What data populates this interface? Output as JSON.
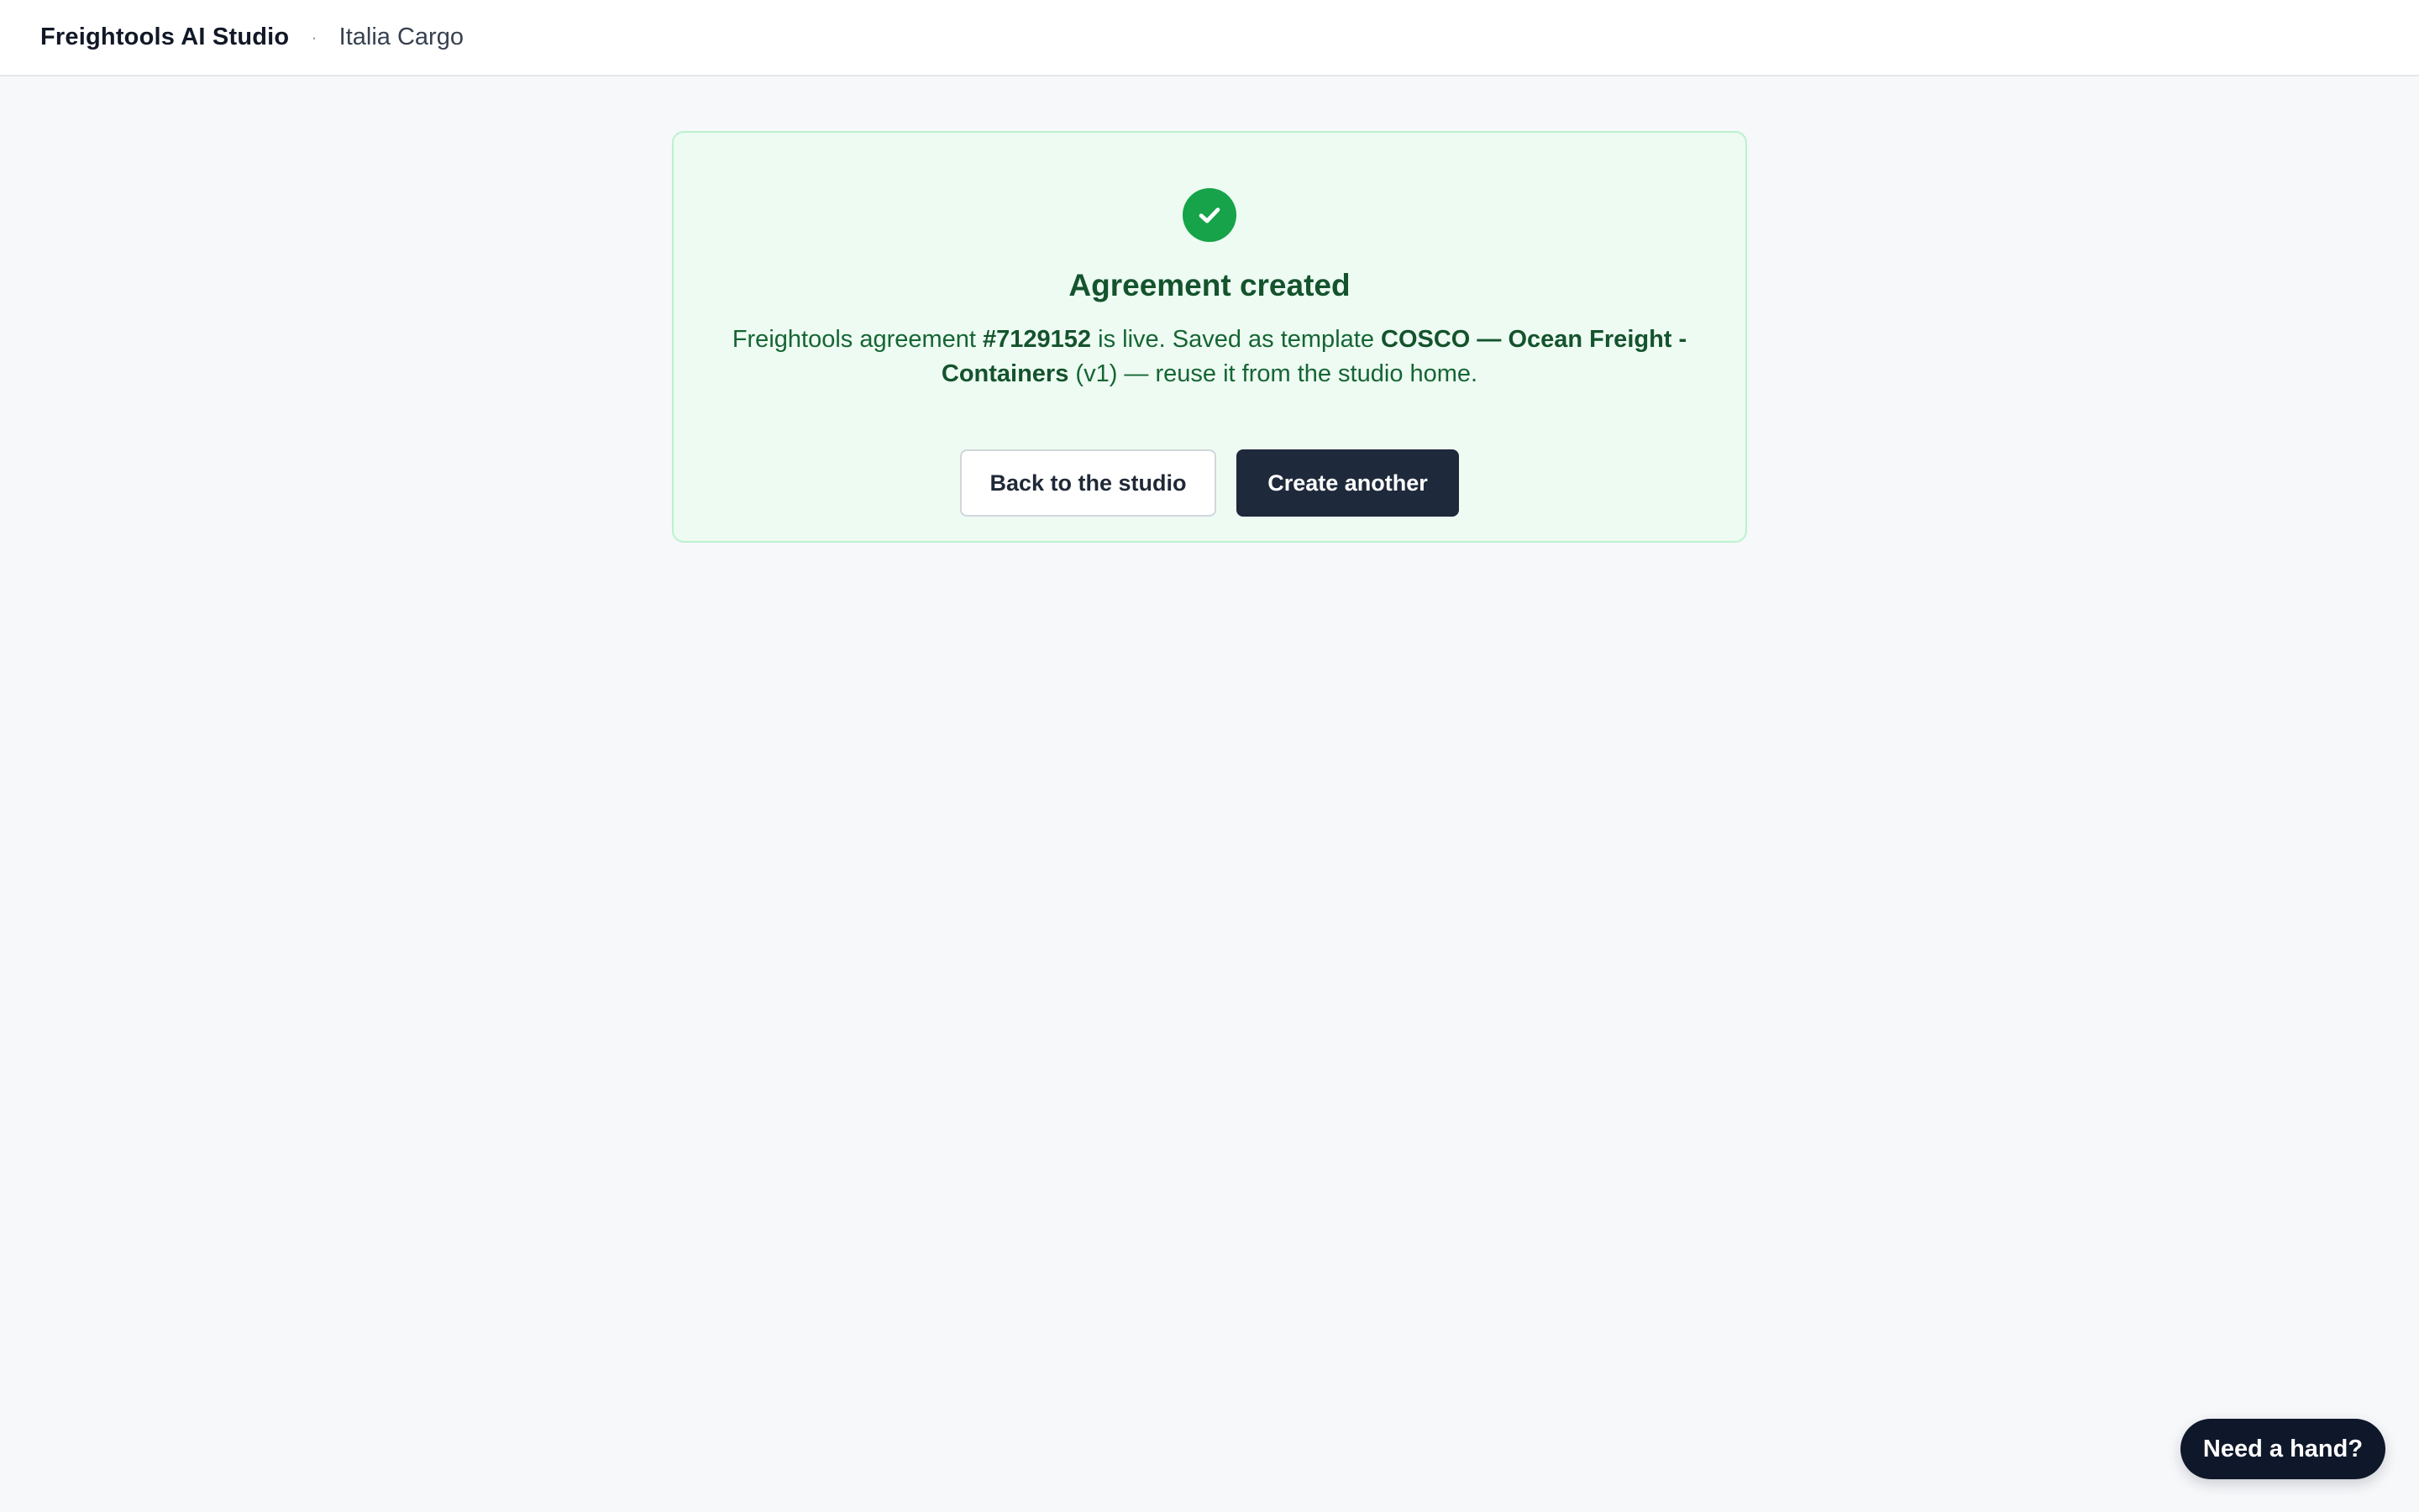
{
  "header": {
    "app_title": "Freightools AI Studio",
    "separator": "·",
    "workspace": "Italia Cargo"
  },
  "success_card": {
    "icon": "check-circle-icon",
    "title": "Agreement created",
    "message": {
      "prefix": "Freightools agreement ",
      "agreement_id": "#7129152",
      "middle": " is live. Saved as template ",
      "template_name": "COSCO — Ocean Freight - Containers",
      "suffix": " (v1) — reuse it from the studio home."
    },
    "back_button_label": "Back to the studio",
    "create_button_label": "Create another"
  },
  "help_button_label": "Need a hand?",
  "colors": {
    "success_bg": "#edfbf2",
    "success_border": "#bbf1cf",
    "success_icon": "#16a34a",
    "success_text": "#14532d",
    "primary_button": "#1e293b",
    "help_button": "#0f172a"
  }
}
